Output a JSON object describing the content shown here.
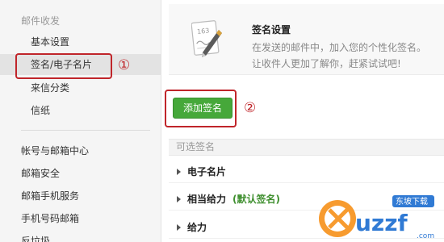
{
  "sidebar": {
    "section_mail": "邮件收发",
    "items_mail": [
      {
        "label": "基本设置"
      },
      {
        "label": "签名/电子名片"
      },
      {
        "label": "来信分类"
      },
      {
        "label": "信纸"
      }
    ],
    "items_account": [
      {
        "label": "帐号与邮箱中心"
      },
      {
        "label": "邮箱安全"
      },
      {
        "label": "邮箱手机服务"
      },
      {
        "label": "手机号码邮箱"
      },
      {
        "label": "反垃圾"
      }
    ],
    "active_index": 1
  },
  "annotations": {
    "step1": "①",
    "step2": "②",
    "color": "#c0252a"
  },
  "header": {
    "title": "签名设置",
    "desc_line1": "在发送的邮件中，加入您的个性化签名。",
    "desc_line2": "让收件人更加了解你，赶紧试试吧!",
    "icon": "signature-doc-pen-icon",
    "icon_number": "163"
  },
  "actions": {
    "add_signature": "添加签名",
    "button_color": "#46a83a"
  },
  "signatures": {
    "header": "可选签名",
    "list": [
      {
        "name": "电子名片",
        "default": ""
      },
      {
        "name": "相当给力",
        "default": "(默认签名)"
      },
      {
        "name": "给力",
        "default": ""
      }
    ]
  },
  "watermark": {
    "brand": "uzzf",
    "tagline": "东坡下载",
    "domain": ".com"
  }
}
